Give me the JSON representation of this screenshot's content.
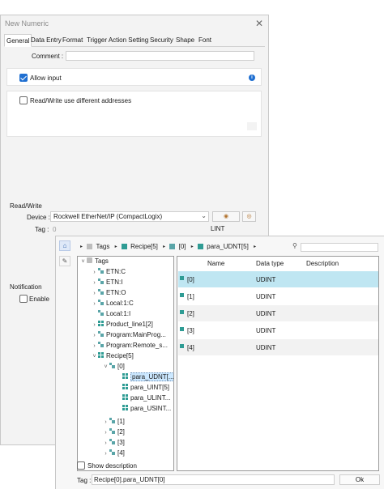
{
  "window": {
    "title": "New Numeric"
  },
  "tabs": [
    {
      "label": "General"
    },
    {
      "label": "Data Entry"
    },
    {
      "label": "Format"
    },
    {
      "label": "Trigger Action Setting"
    },
    {
      "label": "Security"
    },
    {
      "label": "Shape"
    },
    {
      "label": "Font"
    }
  ],
  "general": {
    "comment_label": "Comment :",
    "comment_value": "",
    "allow_input_label": "Allow input",
    "allow_input_checked": true,
    "rw_diff_label": "Read/Write use different addresses",
    "rw_diff_checked": false,
    "readwrite_section": "Read/Write",
    "device_label": "Device :",
    "device_value": "Rockwell EtherNet/IP (CompactLogix)",
    "tag_label": "Tag :",
    "tag_value": "0",
    "data_type_value": "LINT",
    "notification_section": "Notification",
    "enable_label": "Enable",
    "enable_checked": false
  },
  "browser": {
    "breadcrumb": [
      "Tags",
      "Recipe[5]",
      "[0]",
      "para_UDNT[5]"
    ],
    "search_placeholder": "",
    "tree": [
      {
        "label": "Tags",
        "icon": "folder-icon",
        "twisty": "˅"
      },
      {
        "label": "ETN:C",
        "icon": "tag-icon",
        "twisty": "›"
      },
      {
        "label": "ETN:I",
        "icon": "tag-icon",
        "twisty": "›"
      },
      {
        "label": "ETN:O",
        "icon": "tag-icon",
        "twisty": "›"
      },
      {
        "label": "Local:1:C",
        "icon": "tag-icon",
        "twisty": "›"
      },
      {
        "label": "Local:1:I",
        "icon": "tag-icon",
        "twisty": ""
      },
      {
        "label": "Product_line1[2]",
        "icon": "grid-icon",
        "twisty": "›"
      },
      {
        "label": "Program:MainProg...",
        "icon": "tag-icon",
        "twisty": "›"
      },
      {
        "label": "Program:Remote_s...",
        "icon": "tag-icon",
        "twisty": "›"
      },
      {
        "label": "Recipe[5]",
        "icon": "grid-icon",
        "twisty": "˅"
      },
      {
        "label": "[0]",
        "icon": "tag-icon",
        "twisty": "˅"
      },
      {
        "label": "para_UDNT[...",
        "icon": "grid-icon",
        "twisty": "",
        "selected": true
      },
      {
        "label": "para_UINT[5]",
        "icon": "grid-icon",
        "twisty": ""
      },
      {
        "label": "para_ULINT...",
        "icon": "grid-icon",
        "twisty": ""
      },
      {
        "label": "para_USINT...",
        "icon": "grid-icon",
        "twisty": ""
      },
      {
        "label": "[1]",
        "icon": "tag-icon",
        "twisty": "›"
      },
      {
        "label": "[2]",
        "icon": "tag-icon",
        "twisty": "›"
      },
      {
        "label": "[3]",
        "icon": "tag-icon",
        "twisty": "›"
      },
      {
        "label": "[4]",
        "icon": "tag-icon",
        "twisty": "›"
      }
    ],
    "columns": [
      "Name",
      "Data type",
      "Description"
    ],
    "rows": [
      {
        "name": "[0]",
        "type": "UDINT",
        "desc": "",
        "selected": true
      },
      {
        "name": "[1]",
        "type": "UDINT",
        "desc": ""
      },
      {
        "name": "[2]",
        "type": "UDINT",
        "desc": ""
      },
      {
        "name": "[3]",
        "type": "UDINT",
        "desc": ""
      },
      {
        "name": "[4]",
        "type": "UDINT",
        "desc": ""
      }
    ],
    "show_description_label": "Show description",
    "show_description_checked": false,
    "tag_label": "Tag :",
    "tag_value": "Recipe[0].para_UDNT[0]",
    "ok_label": "Ok"
  }
}
